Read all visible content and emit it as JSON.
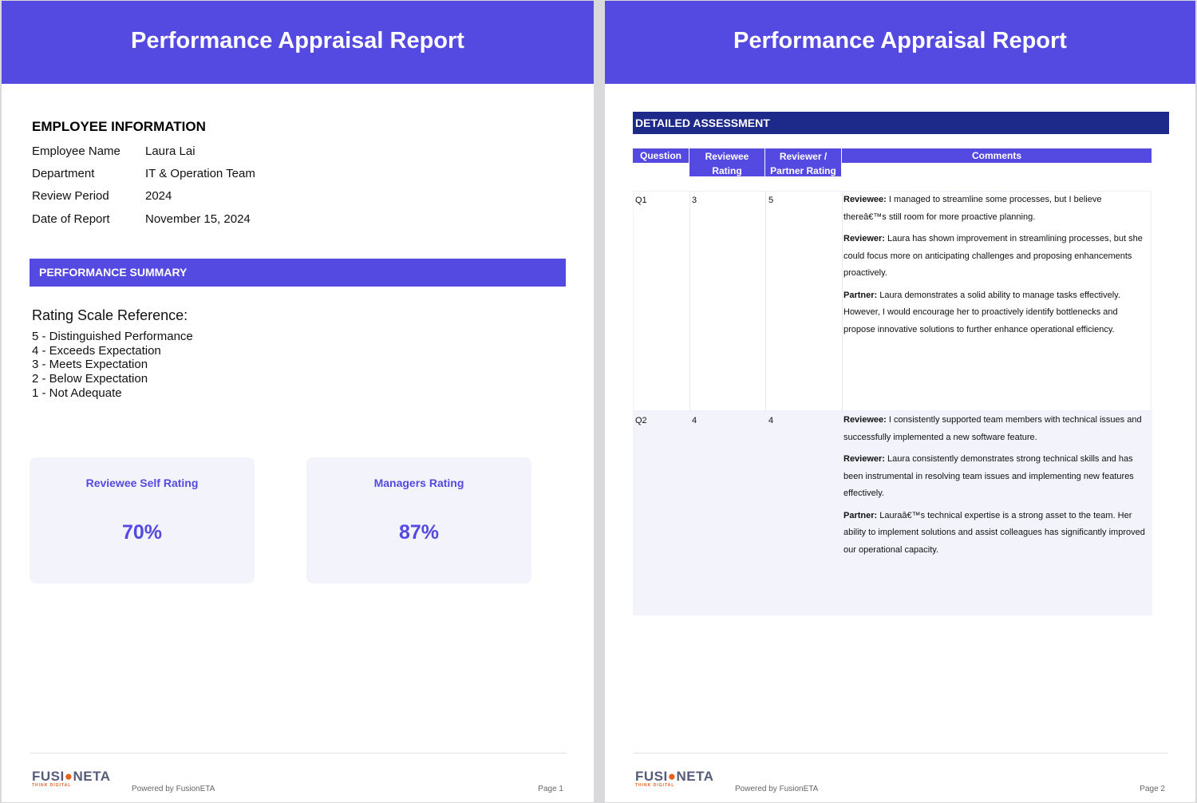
{
  "report_title": "Performance Appraisal Report",
  "employee_info": {
    "heading": "EMPLOYEE INFORMATION",
    "rows": [
      {
        "label": "Employee Name",
        "value": "Laura Lai"
      },
      {
        "label": "Department",
        "value": "IT & Operation Team"
      },
      {
        "label": "Review Period",
        "value": "2024"
      },
      {
        "label": "Date of Report",
        "value": "November 15, 2024"
      }
    ]
  },
  "summary": {
    "heading": "PERFORMANCE SUMMARY",
    "scale_title": "Rating Scale Reference:",
    "scale": [
      "5 - Distinguished Performance",
      "4 - Exceeds Expectation",
      "3 - Meets Expectation",
      "2 - Below Expectation",
      "1 - Not Adequate"
    ],
    "cards": [
      {
        "title": "Reviewee Self Rating",
        "value": "70%"
      },
      {
        "title": "Managers Rating",
        "value": "87%"
      }
    ]
  },
  "assessment": {
    "heading": "DETAILED ASSESSMENT",
    "columns": [
      "Question",
      "Reviewee Rating",
      "Reviewer / Partner Rating",
      "Comments"
    ],
    "rows": [
      {
        "q": "Q1",
        "reviewee": "3",
        "reviewer": "5",
        "comments": [
          {
            "who": "Reviewee:",
            "text": "I managed to streamline some processes, but I believe thereâ€™s still room for more proactive planning."
          },
          {
            "who": "Reviewer:",
            "text": "Laura has shown improvement in streamlining processes, but she could focus more on anticipating challenges and proposing enhancements proactively."
          },
          {
            "who": "Partner:",
            "text": "Laura demonstrates a solid ability to manage tasks effectively. However, I would encourage her to proactively identify bottlenecks and propose innovative solutions to further enhance operational efficiency."
          }
        ]
      },
      {
        "q": "Q2",
        "reviewee": "4",
        "reviewer": "4",
        "comments": [
          {
            "who": "Reviewee:",
            "text": "I consistently supported team members with technical issues and successfully implemented a new software feature."
          },
          {
            "who": "Reviewer:",
            "text": "Laura consistently demonstrates strong technical skills and has been instrumental in resolving team issues and implementing new features effectively."
          },
          {
            "who": "Partner:",
            "text": "Lauraâ€™s technical expertise is a strong asset to the team. Her ability to implement solutions and assist colleagues has significantly improved our operational capacity."
          }
        ]
      }
    ]
  },
  "footer": {
    "logo": "FUSIONETA",
    "logo_tagline": "THINK DIGITAL",
    "powered": "Powered by FusionETA",
    "pages": [
      "Page 1",
      "Page 2"
    ]
  },
  "colors": {
    "primary": "#5449e0",
    "navy": "#1e2a8a",
    "accent": "#e8601c"
  }
}
